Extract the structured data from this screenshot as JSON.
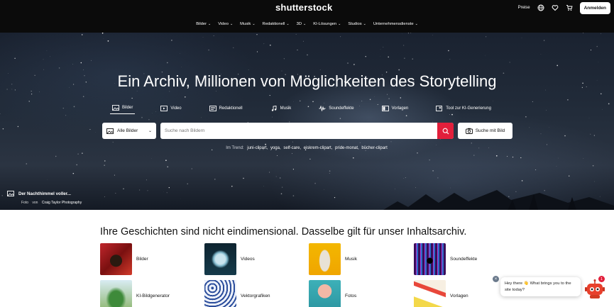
{
  "header": {
    "logo": "shutterstock",
    "pricing_label": "Preise",
    "signin_label": "Anmelden",
    "nav": [
      {
        "label": "Bilder"
      },
      {
        "label": "Video"
      },
      {
        "label": "Musik"
      },
      {
        "label": "Redaktionell"
      },
      {
        "label": "3D"
      },
      {
        "label": "KI-Lösungen"
      },
      {
        "label": "Studios"
      },
      {
        "label": "Unternehmensdienste"
      }
    ]
  },
  "hero": {
    "title": "Ein Archiv, Millionen von Möglichkeiten des Storytelling",
    "tabs": [
      {
        "label": "Bilder",
        "icon": "image-icon"
      },
      {
        "label": "Video",
        "icon": "video-icon"
      },
      {
        "label": "Redaktionell",
        "icon": "newspaper-icon"
      },
      {
        "label": "Musik",
        "icon": "music-note-icon"
      },
      {
        "label": "Soundeffekte",
        "icon": "waveform-icon"
      },
      {
        "label": "Vorlagen",
        "icon": "template-icon"
      },
      {
        "label": "Tool zur KI-Generierung",
        "icon": "ai-sparkle-icon"
      }
    ],
    "search": {
      "type_selected": "Alle Bilder",
      "placeholder": "Suche nach Bildern",
      "image_search_label": "Suche mit Bild"
    },
    "trending": {
      "label": "Im Trend:",
      "terms": [
        "juni-clipart,",
        "yoga,",
        "self-care,",
        "eiskrem-clipart,",
        "pride-monat,",
        "bücher-clipart"
      ]
    },
    "credit": {
      "title": "Der Nachthimmel voller...",
      "type": "Foto",
      "by": "von",
      "author": "Craig Taylor Photography"
    }
  },
  "content": {
    "section_title": "Ihre Geschichten sind nicht eindimensional. Dasselbe gilt für unser Inhaltsarchiv.",
    "categories": [
      {
        "label": "Bilder"
      },
      {
        "label": "Videos"
      },
      {
        "label": "Musik"
      },
      {
        "label": "Soundeffekte"
      },
      {
        "label": "KI-Bildgenerator"
      },
      {
        "label": "Vektorgrafiken"
      },
      {
        "label": "Fotos"
      },
      {
        "label": "Vorlagen"
      }
    ]
  },
  "chat": {
    "message": "Hey there 👋 What brings you to the site today?",
    "close": "×",
    "badge": "1"
  },
  "colors": {
    "accent": "#e21f3b",
    "header_bg": "#0b0b0b"
  }
}
